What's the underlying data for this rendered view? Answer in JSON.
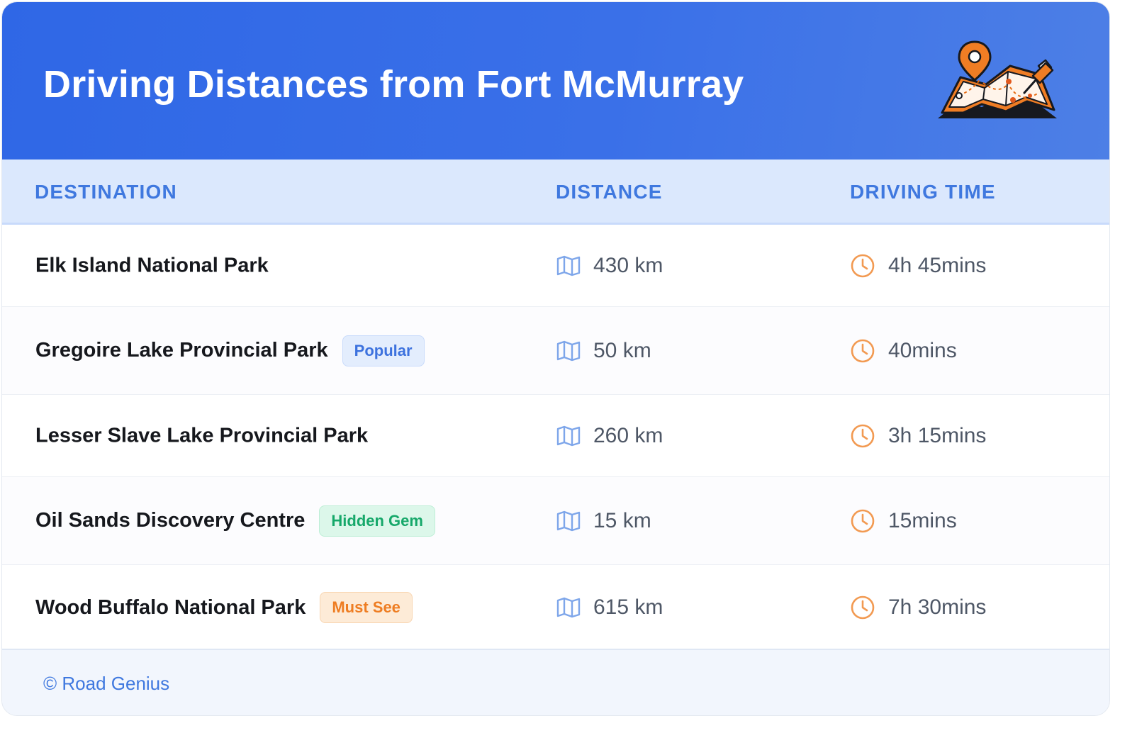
{
  "header": {
    "title": "Driving Distances from Fort McMurray",
    "illustration_icon": "map-with-pins-icon"
  },
  "table": {
    "columns": [
      "DESTINATION",
      "DISTANCE",
      "DRIVING TIME"
    ],
    "rows": [
      {
        "destination": "Elk Island National Park",
        "badge": "",
        "distance": "430 km",
        "time": "4h 45mins"
      },
      {
        "destination": "Gregoire Lake Provincial Park",
        "badge": "Popular",
        "badge_style": "blue",
        "distance": "50 km",
        "time": "40mins"
      },
      {
        "destination": "Lesser Slave Lake Provincial Park",
        "badge": "",
        "distance": "260 km",
        "time": "3h 15mins"
      },
      {
        "destination": "Oil Sands Discovery Centre",
        "badge": "Hidden Gem",
        "badge_style": "green",
        "distance": "15 km",
        "time": "15mins"
      },
      {
        "destination": "Wood Buffalo National Park",
        "badge": "Must See",
        "badge_style": "orange",
        "distance": "615 km",
        "time": "7h 30mins"
      }
    ],
    "distance_icon": "folded-map-icon",
    "time_icon": "clock-icon"
  },
  "footer": {
    "text": "© Road Genius"
  },
  "colors": {
    "header_blue": "#2f67e6",
    "accent_blue": "#3f78df",
    "accent_orange": "#ee7d22",
    "badge_green": "#16a86a"
  }
}
